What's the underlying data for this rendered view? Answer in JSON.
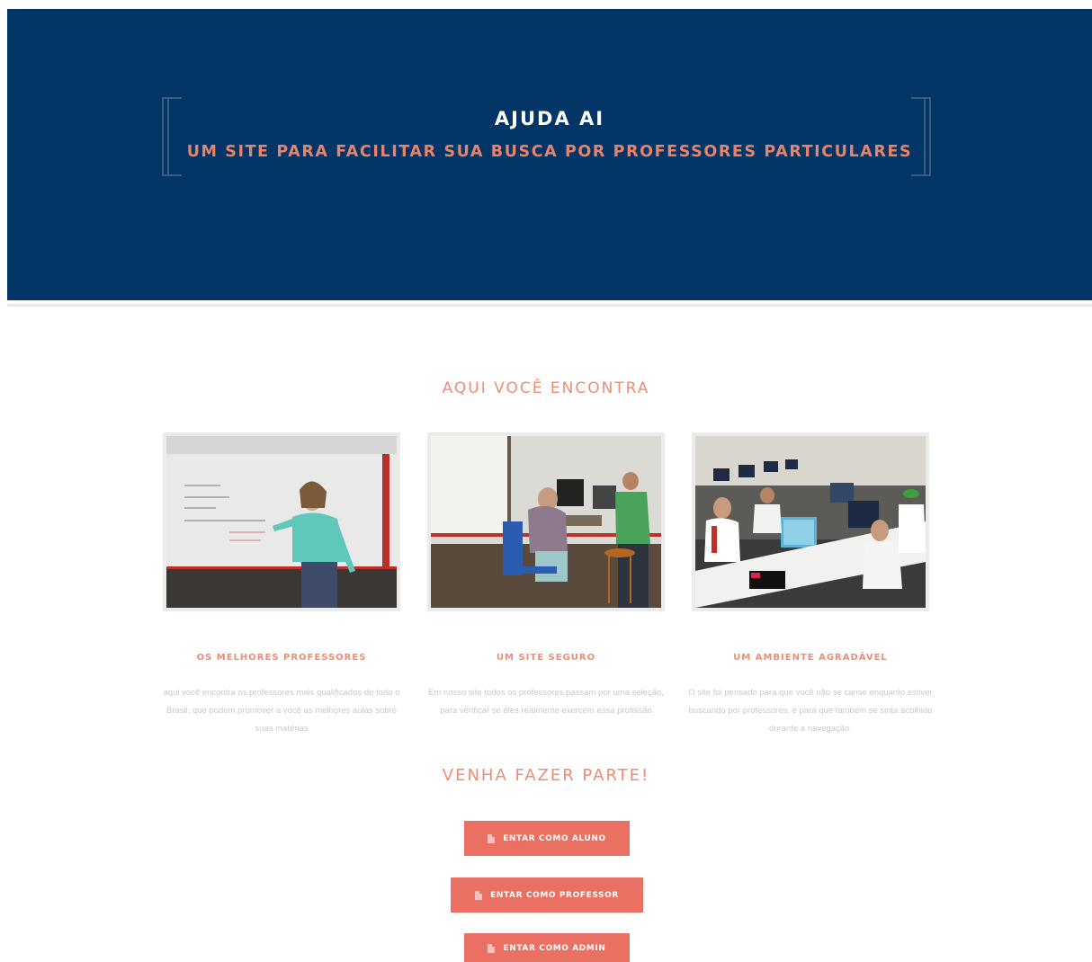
{
  "hero": {
    "title": "AJUDA AI",
    "subtitle": "UM SITE PARA FACILITAR SUA BUSCA POR PROFESSORES PARTICULARES",
    "background_color": "#033566",
    "accent_color": "#e8836a"
  },
  "features": {
    "heading": "AQUI VOCÊ ENCONTRA",
    "cards": [
      {
        "title": "OS MELHORES PROFESSORES",
        "description": "aqui você encontra os professores mais qualificados de todo o Brasil, que podem promover a você as melhores aulas sobre suas matérias",
        "photo": "teacher-at-whiteboard-photo"
      },
      {
        "title": "UM SITE SEGURO",
        "description": "Em nosso site todos os professores passam por uma seleção, para verificar se eles realmente exercem essa profissão",
        "photo": "computer-lab-teacher-photo"
      },
      {
        "title": "UM AMBIENTE AGRADÁVEL",
        "description": "O site foi pensado para que você não se canse enquanto estiver buscando por professores, e para que também se sinta acolhido durante a navegação.",
        "photo": "students-in-computer-lab-photo"
      }
    ]
  },
  "join": {
    "heading": "VENHA FAZER PARTE!",
    "buttons": [
      {
        "label": "ENTAR COMO ALUNO",
        "icon": "document-icon"
      },
      {
        "label": "ENTAR COMO PROFESSOR",
        "icon": "document-icon"
      },
      {
        "label": "ENTAR COMO ADMIN",
        "icon": "document-icon"
      }
    ],
    "button_color": "#ea7063"
  }
}
